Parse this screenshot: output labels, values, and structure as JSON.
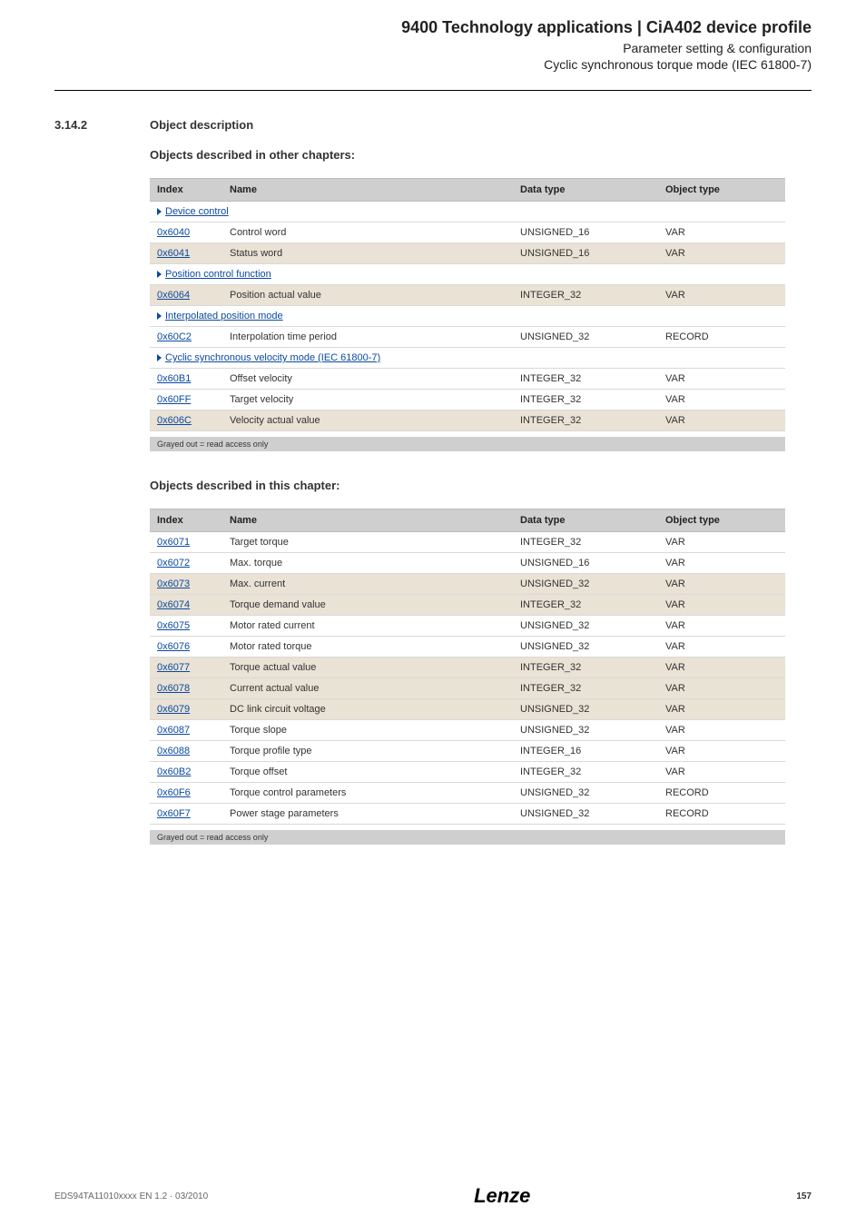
{
  "header": {
    "title": "9400 Technology applications | CiA402 device profile",
    "sub1": "Parameter setting & configuration",
    "sub2": "Cyclic synchronous torque mode (IEC 61800-7)"
  },
  "sec": {
    "num": "3.14.2",
    "title": "Object description",
    "sub_other": "Objects described in other chapters:",
    "sub_this": "Objects described in this chapter:"
  },
  "th": {
    "index": "Index",
    "name": "Name",
    "dtype": "Data type",
    "otype": "Object type"
  },
  "groups1": {
    "g0": "Device control",
    "g1": "Position control function",
    "g2": "Interpolated position mode",
    "g3": "Cyclic synchronous velocity mode (IEC 61800-7)"
  },
  "t1": {
    "r0": {
      "index": "0x6040",
      "name": "Control word",
      "dtype": "UNSIGNED_16",
      "otype": "VAR"
    },
    "r1": {
      "index": "0x6041",
      "name": "Status word",
      "dtype": "UNSIGNED_16",
      "otype": "VAR"
    },
    "r2": {
      "index": "0x6064",
      "name": "Position actual value",
      "dtype": "INTEGER_32",
      "otype": "VAR"
    },
    "r3": {
      "index": "0x60C2",
      "name": "Interpolation time period",
      "dtype": "UNSIGNED_32",
      "otype": "RECORD"
    },
    "r4": {
      "index": "0x60B1",
      "name": "Offset velocity",
      "dtype": "INTEGER_32",
      "otype": "VAR"
    },
    "r5": {
      "index": "0x60FF",
      "name": "Target velocity",
      "dtype": "INTEGER_32",
      "otype": "VAR"
    },
    "r6": {
      "index": "0x606C",
      "name": "Velocity actual value",
      "dtype": "INTEGER_32",
      "otype": "VAR"
    }
  },
  "t2": {
    "r0": {
      "index": "0x6071",
      "name": "Target torque",
      "dtype": "INTEGER_32",
      "otype": "VAR"
    },
    "r1": {
      "index": "0x6072",
      "name": "Max. torque",
      "dtype": "UNSIGNED_16",
      "otype": "VAR"
    },
    "r2": {
      "index": "0x6073",
      "name": "Max. current",
      "dtype": "UNSIGNED_32",
      "otype": "VAR"
    },
    "r3": {
      "index": "0x6074",
      "name": "Torque demand value",
      "dtype": "INTEGER_32",
      "otype": "VAR"
    },
    "r4": {
      "index": "0x6075",
      "name": "Motor rated current",
      "dtype": "UNSIGNED_32",
      "otype": "VAR"
    },
    "r5": {
      "index": "0x6076",
      "name": "Motor rated torque",
      "dtype": "UNSIGNED_32",
      "otype": "VAR"
    },
    "r6": {
      "index": "0x6077",
      "name": "Torque actual value",
      "dtype": "INTEGER_32",
      "otype": "VAR"
    },
    "r7": {
      "index": "0x6078",
      "name": "Current actual value",
      "dtype": "INTEGER_32",
      "otype": "VAR"
    },
    "r8": {
      "index": "0x6079",
      "name": "DC link circuit voltage",
      "dtype": "UNSIGNED_32",
      "otype": "VAR"
    },
    "r9": {
      "index": "0x6087",
      "name": "Torque slope",
      "dtype": "UNSIGNED_32",
      "otype": "VAR"
    },
    "r10": {
      "index": "0x6088",
      "name": "Torque profile type",
      "dtype": "INTEGER_16",
      "otype": "VAR"
    },
    "r11": {
      "index": "0x60B2",
      "name": "Torque offset",
      "dtype": "INTEGER_32",
      "otype": "VAR"
    },
    "r12": {
      "index": "0x60F6",
      "name": "Torque control parameters",
      "dtype": "UNSIGNED_32",
      "otype": "RECORD"
    },
    "r13": {
      "index": "0x60F7",
      "name": "Power stage parameters",
      "dtype": "UNSIGNED_32",
      "otype": "RECORD"
    }
  },
  "note": "Grayed out = read access only",
  "footer": {
    "doc": "EDS94TA11010xxxx EN 1.2 · 03/2010",
    "logo": "Lenze",
    "page": "157"
  }
}
